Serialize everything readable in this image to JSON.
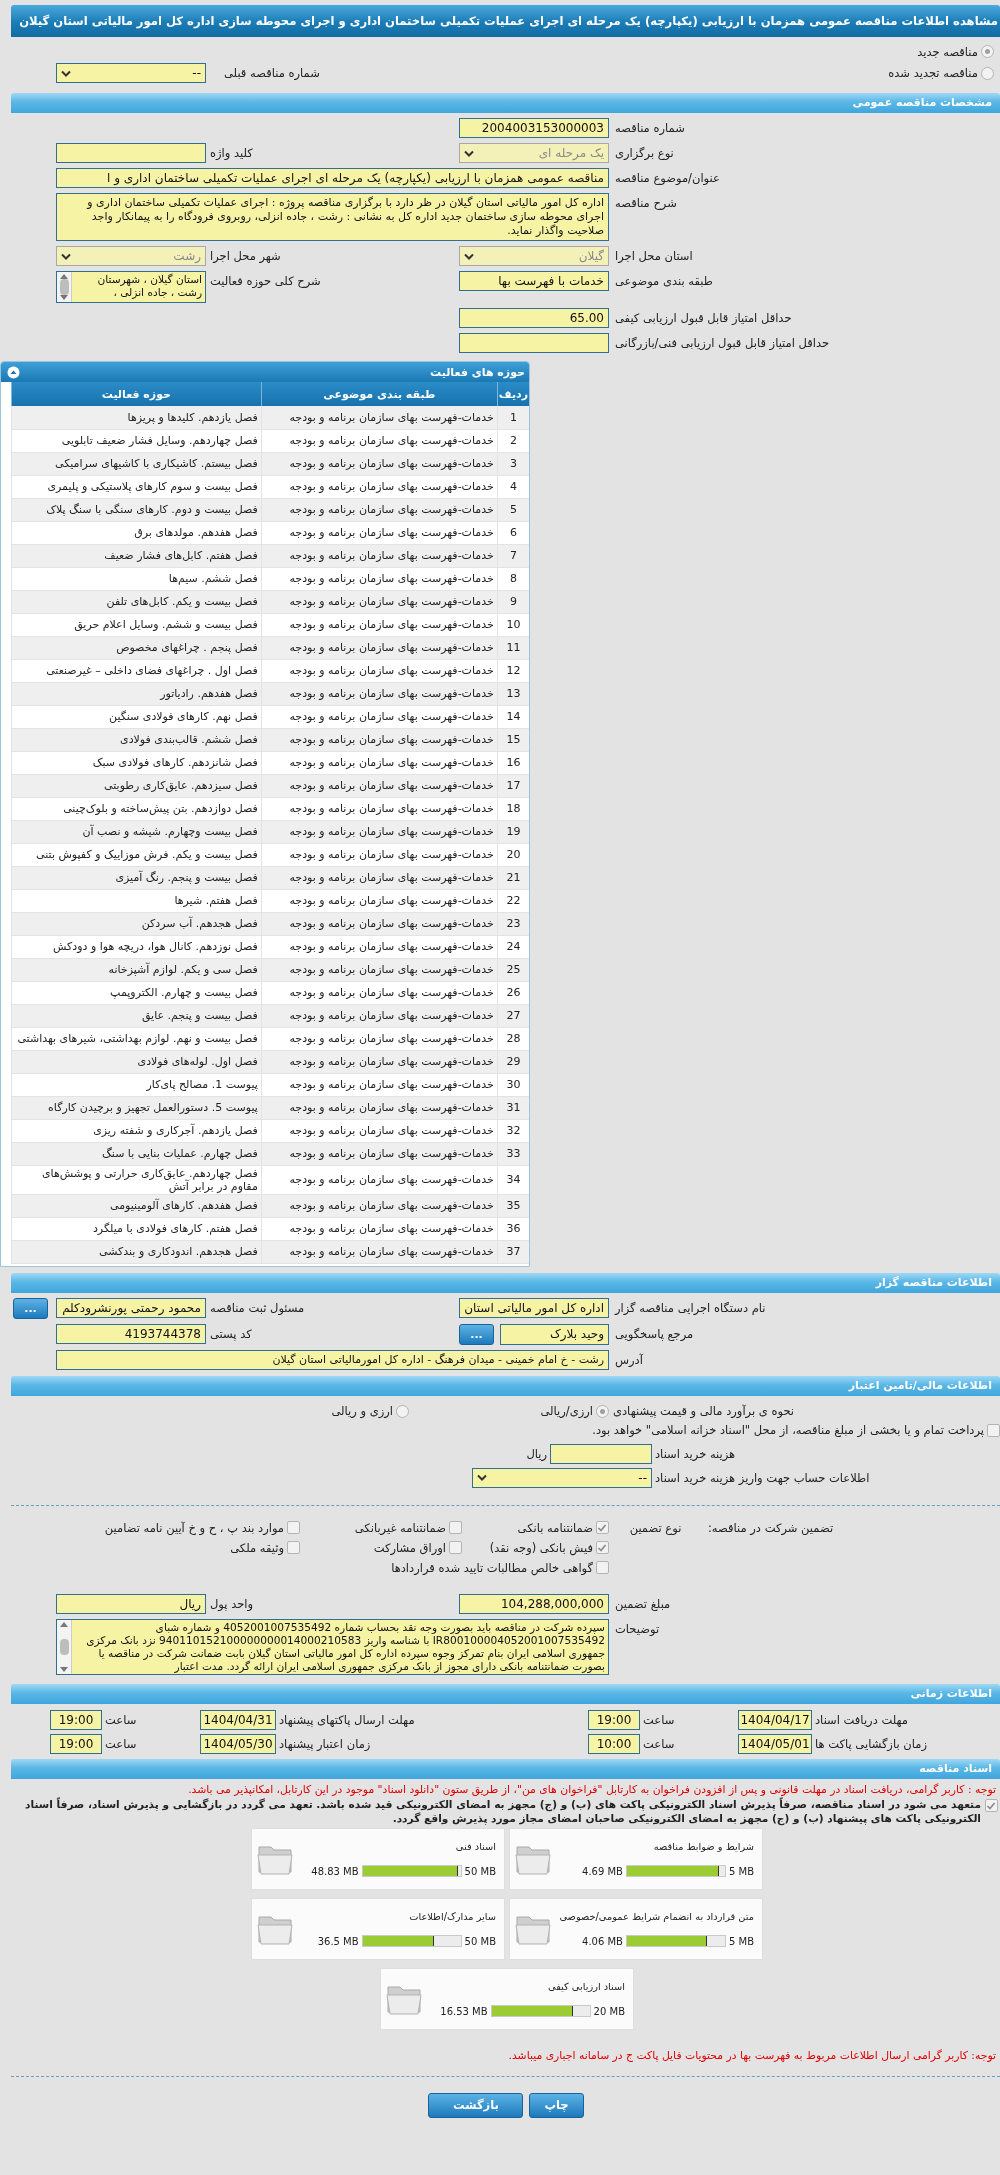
{
  "title_bar": {
    "title": "مشاهده اطلاعات مناقصه عمومی همزمان با ارزیابی (یکپارچه) یک مرحله ای اجرای عملیات تکمیلی ساختمان اداری و اجرای محوطه سازی اداره کل امور مالیاتی استان گیلان"
  },
  "tender_status": {
    "options": [
      {
        "label": "مناقصه جدید",
        "selected": true
      },
      {
        "label": "مناقصه تجدید شده",
        "selected": false
      }
    ],
    "previous_tender": {
      "label": "شماره مناقصه قبلی",
      "value": "--"
    }
  },
  "general": {
    "title": "مشخصات مناقصه عمومی",
    "rows": [
      {
        "fields": [
          {
            "label": "شماره مناقصه",
            "kind": "text",
            "value": "2004003153000003"
          }
        ]
      },
      {
        "fields": [
          {
            "label": "نوع برگزاری",
            "kind": "select",
            "value": "یک مرحله ای",
            "disabled": true
          },
          {
            "label": "کلید واژه",
            "kind": "text"
          }
        ]
      },
      {
        "fields": [
          {
            "label": "عنوان/موضوع مناقصه",
            "kind": "wide",
            "value": "مناقصه عمومی همزمان با ارزیابی (یکپارچه) یک مرحله ای اجرای عملیات تکمیلی ساختمان اداری و ا"
          }
        ]
      },
      {
        "fields": [
          {
            "label": "شرح مناقصه",
            "kind": "textarea",
            "value": "اداره کل امور مالیاتی استان گیلان در ظر دارد با برگزاری مناقصه پروژه : اجرای عملیات تکمیلی ساختمان اداری و اجرای محوطه سازی ساختمان جدید اداره کل به نشانی : رشت ، جاده انزلی، روبروی فرودگاه را به پیمانکار واجد صلاحیت واگذار نماید."
          }
        ]
      },
      {
        "fields": [
          {
            "label": "استان محل اجرا",
            "kind": "select",
            "value": "گیلان",
            "disabled": true
          },
          {
            "label": "شهر محل اجرا",
            "kind": "select",
            "value": "رشت",
            "disabled": true
          }
        ]
      },
      {
        "fields": [
          {
            "label": "طبقه بندی موضوعی",
            "kind": "text",
            "value": "خدمات با فهرست بها"
          },
          {
            "label": "شرح کلی حوزه فعالیت",
            "kind": "scrollbox",
            "value": "استان گیلان ، شهرستان رشت ، جاده انزلی ،"
          }
        ]
      },
      {
        "fields": [
          {
            "label": "حداقل امتیاز قابل قبول ارزیابی کیفی",
            "kind": "text",
            "value": "65.00"
          }
        ]
      },
      {
        "fields": [
          {
            "label": "حداقل امتیاز قابل قبول ارزیابی فنی/بازرگانی",
            "kind": "text"
          }
        ]
      }
    ]
  },
  "activity_table": {
    "title": "حوزه های فعالیت",
    "columns": [
      "ردیف",
      "طبقه بندی موضوعی",
      "حوزه فعالیت"
    ],
    "rows": [
      {
        "index": "1",
        "category": "خدمات-فهرست بهای سازمان برنامه و بودجه",
        "activity": "فصل یازدهم. کلیدها و پریزها"
      },
      {
        "index": "2",
        "category": "خدمات-فهرست بهای سازمان برنامه و بودجه",
        "activity": "فصل چهاردهم. وسایل فشار ضعیف تابلویی"
      },
      {
        "index": "3",
        "category": "خدمات-فهرست بهای سازمان برنامه و بودجه",
        "activity": "فصل بیستم. کاشیکاری با کاشیهای سرامیکی"
      },
      {
        "index": "4",
        "category": "خدمات-فهرست بهای سازمان برنامه و بودجه",
        "activity": "فصل بیست و سوم کارهای پلاستیکی و پلیمری"
      },
      {
        "index": "5",
        "category": "خدمات-فهرست بهای سازمان برنامه و بودجه",
        "activity": "فصل بیست و دوم. کارهای سنگی با سنگ پلاک"
      },
      {
        "index": "6",
        "category": "خدمات-فهرست بهای سازمان برنامه و بودجه",
        "activity": "فصل هفدهم. مولدهای برق"
      },
      {
        "index": "7",
        "category": "خدمات-فهرست بهای سازمان برنامه و بودجه",
        "activity": "فصل هفتم. کابل‌های فشار ضعیف"
      },
      {
        "index": "8",
        "category": "خدمات-فهرست بهای سازمان برنامه و بودجه",
        "activity": "فصل ششم. سیم‌ها"
      },
      {
        "index": "9",
        "category": "خدمات-فهرست بهای سازمان برنامه و بودجه",
        "activity": "فصل بیست و یکم. کابل‌های تلفن"
      },
      {
        "index": "10",
        "category": "خدمات-فهرست بهای سازمان برنامه و بودجه",
        "activity": "فصل بیست و ششم. وسایل اعلام حریق"
      },
      {
        "index": "11",
        "category": "خدمات-فهرست بهای سازمان برنامه و بودجه",
        "activity": "فصل پنجم . چراغهای مخصوص"
      },
      {
        "index": "12",
        "category": "خدمات-فهرست بهای سازمان برنامه و بودجه",
        "activity": "فصل اول . چراغهای فضای داخلی – غیرصنعتی"
      },
      {
        "index": "13",
        "category": "خدمات-فهرست بهای سازمان برنامه و بودجه",
        "activity": "فصل هفدهم. رادیاتور"
      },
      {
        "index": "14",
        "category": "خدمات-فهرست بهای سازمان برنامه و بودجه",
        "activity": "فصل نهم. کارهای فولادی سنگین"
      },
      {
        "index": "15",
        "category": "خدمات-فهرست بهای سازمان برنامه و بودجه",
        "activity": "فصل ششم. قالب‌بندی فولادی"
      },
      {
        "index": "16",
        "category": "خدمات-فهرست بهای سازمان برنامه و بودجه",
        "activity": "فصل شانزدهم. کارهای فولادی سبک"
      },
      {
        "index": "17",
        "category": "خدمات-فهرست بهای سازمان برنامه و بودجه",
        "activity": "فصل سیزدهم. عایق‌کاری رطوبتی"
      },
      {
        "index": "18",
        "category": "خدمات-فهرست بهای سازمان برنامه و بودجه",
        "activity": "فصل دوازدهم. بتن پیش‌ساخته و بلوک‌چینی"
      },
      {
        "index": "19",
        "category": "خدمات-فهرست بهای سازمان برنامه و بودجه",
        "activity": "فصل بیست وچهارم. شیشه و نصب آن"
      },
      {
        "index": "20",
        "category": "خدمات-فهرست بهای سازمان برنامه و بودجه",
        "activity": "فصل بیست و یکم. فرش موزاییک و کفپوش بتنی"
      },
      {
        "index": "21",
        "category": "خدمات-فهرست بهای سازمان برنامه و بودجه",
        "activity": "فصل بیست و پنجم. رنگ آمیزی"
      },
      {
        "index": "22",
        "category": "خدمات-فهرست بهای سازمان برنامه و بودجه",
        "activity": "فصل هفتم. شیرها"
      },
      {
        "index": "23",
        "category": "خدمات-فهرست بهای سازمان برنامه و بودجه",
        "activity": "فصل هجدهم. آب سردکن"
      },
      {
        "index": "24",
        "category": "خدمات-فهرست بهای سازمان برنامه و بودجه",
        "activity": "فصل نوزدهم. کانال هوا، دریچه هوا و دودکش"
      },
      {
        "index": "25",
        "category": "خدمات-فهرست بهای سازمان برنامه و بودجه",
        "activity": "فصل سی و یکم. لوازم آشپزخانه"
      },
      {
        "index": "26",
        "category": "خدمات-فهرست بهای سازمان برنامه و بودجه",
        "activity": "فصل بیست و چهارم. الکتروپمپ"
      },
      {
        "index": "27",
        "category": "خدمات-فهرست بهای سازمان برنامه و بودجه",
        "activity": "فصل بیست و پنجم. عایق"
      },
      {
        "index": "28",
        "category": "خدمات-فهرست بهای سازمان برنامه و بودجه",
        "activity": "فصل بیست و نهم. لوازم بهداشتی، شیرهای بهداشتی"
      },
      {
        "index": "29",
        "category": "خدمات-فهرست بهای سازمان برنامه و بودجه",
        "activity": "فصل اول. لوله‌های فولادی"
      },
      {
        "index": "30",
        "category": "خدمات-فهرست بهای سازمان برنامه و بودجه",
        "activity": "پیوست 1. مصالح پای‌کار"
      },
      {
        "index": "31",
        "category": "خدمات-فهرست بهای سازمان برنامه و بودجه",
        "activity": "پیوست 5. دستورالعمل تجهیز و برچیدن کارگاه"
      },
      {
        "index": "32",
        "category": "خدمات-فهرست بهای سازمان برنامه و بودجه",
        "activity": "فصل یازدهم. آجرکاری و شفته ریزی"
      },
      {
        "index": "33",
        "category": "خدمات-فهرست بهای سازمان برنامه و بودجه",
        "activity": "فصل چهارم. عملیات بنایی با سنگ"
      },
      {
        "index": "34",
        "category": "خدمات-فهرست بهای سازمان برنامه و بودجه",
        "activity": "فصل چهاردهم. عایق‌کاری حرارتی و پوشش‌های مقاوم در برابر آتش"
      },
      {
        "index": "35",
        "category": "خدمات-فهرست بهای سازمان برنامه و بودجه",
        "activity": "فصل هفدهم. کارهای آلومینیومی"
      },
      {
        "index": "36",
        "category": "خدمات-فهرست بهای سازمان برنامه و بودجه",
        "activity": "فصل هفتم. کارهای فولادی با میلگرد"
      },
      {
        "index": "37",
        "category": "خدمات-فهرست بهای سازمان برنامه و بودجه",
        "activity": "فصل هجدهم. اندودکاری و بندکشی"
      }
    ]
  },
  "organizer": {
    "title": "اطلاعات مناقصه گزار",
    "rows": [
      {
        "fields": [
          {
            "label": "نام دستگاه اجرایی مناقصه گزار",
            "kind": "text",
            "value": "اداره کل امور مالیاتی استان"
          },
          {
            "label": "مسئول ثبت مناقصه",
            "kind": "text",
            "value": "محمود رحمتی پورنشرودکلم",
            "button": "..."
          }
        ]
      },
      {
        "fields": [
          {
            "label": "مرجع پاسخگویی",
            "kind": "text",
            "value": "وحید بلارک",
            "button": "..."
          },
          {
            "label": "کد پستی",
            "kind": "text",
            "value": "4193744378"
          }
        ]
      },
      {
        "fields": [
          {
            "label": "آدرس",
            "kind": "textarea",
            "value": "رشت - خ امام خمینی -  میدان فرهنگ - اداره کل امورمالیاتی استان گیلان"
          }
        ]
      }
    ]
  },
  "finance": {
    "title": "اطلاعات مالی/تامین اعتبار",
    "estimate": {
      "label": "نحوه ی برآورد مالی و قیمت پیشنهادی",
      "options": [
        {
          "label": "ارزی/ریالی",
          "selected": true
        },
        {
          "label": "ارزی و ریالی",
          "selected": false
        }
      ]
    },
    "treasury": {
      "label": "پرداخت تمام و یا بخشی از مبلغ مناقصه، از محل \"اسناد خزانه اسلامی\" خواهد بود.",
      "checked": false
    },
    "purchase_cost": {
      "label": "هزینه خرید اسناد",
      "unit": "ریال"
    },
    "account": {
      "label": "اطلاعات حساب جهت واریز هزینه خرید اسناد",
      "value": "--"
    },
    "guarantee": {
      "label": "تضمین شرکت در مناقصه:",
      "type_label": "نوع تضمین",
      "options": [
        {
          "label": "ضمانتنامه بانکی",
          "checked": true
        },
        {
          "label": "ضمانتنامه غیربانکی",
          "checked": false
        },
        {
          "label": "موارد بند پ ، ح و خ آیین نامه تضامین",
          "checked": false
        },
        {
          "label": "فیش بانکی (وجه نقد)",
          "checked": true
        },
        {
          "label": "اوراق مشارکت",
          "checked": false
        },
        {
          "label": "وثیقه ملکی",
          "checked": false
        },
        {
          "label": "گواهی خالص مطالبات تایید شده قراردادها",
          "checked": false
        }
      ]
    },
    "rows": [
      {
        "fields": [
          {
            "label": "مبلغ تضمین",
            "kind": "text",
            "value": "104,288,000,000"
          },
          {
            "label": "واحد پول",
            "kind": "text",
            "value": "ریال"
          }
        ]
      },
      {
        "fields": [
          {
            "label": "توضیحات",
            "kind": "scrollbox",
            "value": "سپرده شرکت در مناقصه باید بصورت وجه نقد بحساب شماره 4052001007535492 و شماره شبای IR800100004052001007535492 با شناسه واریز 940110152100000000014000210583 نزد بانک مرکزی جمهوری اسلامی ایران بنام تمرکز وجوه سپرده اداره کل امور مالیاتی استان گیلان بابت ضمانت شرکت در مناقصه یا بصورت ضمانتنامه بانکی دارای مجوز از بانک مرکزی جمهوری اسلامی ایران ارائه گردد. مدت اعتبار"
          }
        ]
      }
    ]
  },
  "timing": {
    "title": "اطلاعات زمانی",
    "rows": [
      {
        "items": [
          {
            "label": "مهلت دریافت اسناد",
            "date": "1404/04/17",
            "time_label": "ساعت",
            "time": "19:00"
          },
          {
            "label": "مهلت ارسال پاکتهای پیشنهاد",
            "date": "1404/04/31",
            "time_label": "ساعت",
            "time": "19:00"
          }
        ]
      },
      {
        "items": [
          {
            "label": "زمان بازگشایی پاکت ها",
            "date": "1404/05/01",
            "time_label": "ساعت",
            "time": "10:00"
          },
          {
            "label": "زمان اعتبار پیشنهاد",
            "date": "1404/05/30",
            "time_label": "ساعت",
            "time": "19:00"
          }
        ]
      }
    ]
  },
  "documents": {
    "title": "اسناد مناقصه",
    "notice": "توجه : کاربر گرامی، دریافت اسناد در مهلت قانونی و پس از افزودن فراخوان به کارتابل \"فراخوان های من\"، از طریق ستون \"دانلود اسناد\" موجود در این کارتابل، امکانپذیر می باشد.",
    "commitment": {
      "text": "متعهد می شود در اسناد مناقصه، صرفاً پذیرش اسناد الکترونیکی پاکت های (ب) و (ج) مجهز به امضای الکترونیکی قید شده باشد. تعهد می گردد در بازگشایی و پذیرش اسناد، صرفاً اسناد الکترونیکی پاکت های پیشنهاد (ب) و (ج) مجهز به امضای الکترونیکی صاحبان امضای مجاز مورد پذیرش واقع گردد.",
      "checked": true
    },
    "files": [
      {
        "name": "شرایط و ضوابط مناقصه",
        "max": "5 MB",
        "size": "4.69 MB",
        "level": 0.938
      },
      {
        "name": "اسناد فنی",
        "max": "50 MB",
        "size": "48.83 MB",
        "level": 0.977
      },
      {
        "name": "متن قرارداد به انضمام شرایط عمومی/خصوصی",
        "max": "5 MB",
        "size": "4.06 MB",
        "level": 0.812
      },
      {
        "name": "سایر مدارک/اطلاعات",
        "max": "50 MB",
        "size": "36.5 MB",
        "level": 0.73
      },
      {
        "name": "اسناد ارزیابی کیفی",
        "max": "20 MB",
        "size": "16.53 MB",
        "level": 0.827
      }
    ],
    "footer_notice": "توجه: کاربر گرامی ارسال اطلاعات مربوط به فهرست بها در محتویات فایل پاکت ج در سامانه اجباری میباشد."
  },
  "buttons": [
    "چاپ",
    "بازگشت"
  ]
}
